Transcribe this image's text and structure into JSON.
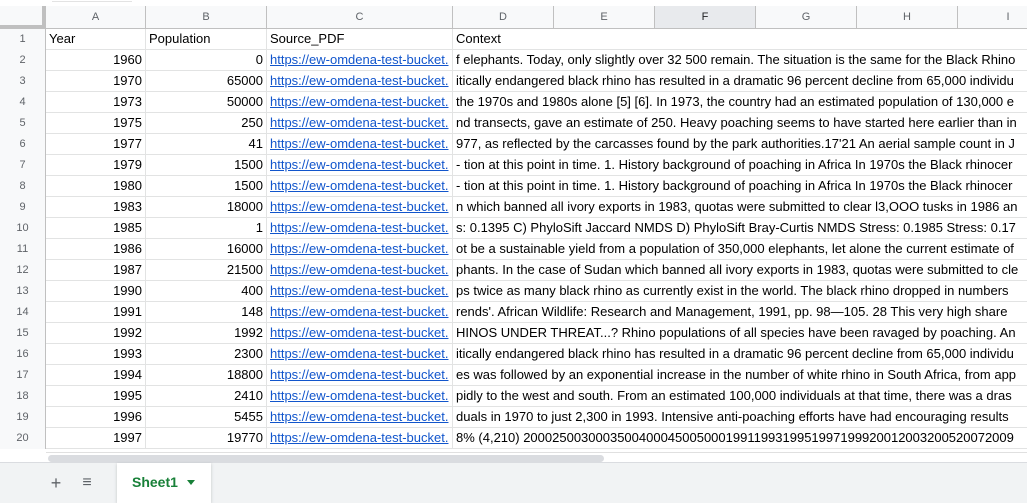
{
  "sheet": {
    "columns": [
      "A",
      "B",
      "C",
      "D",
      "E",
      "F",
      "G",
      "H",
      "I"
    ],
    "selected_column": "F",
    "headers": {
      "year": "Year",
      "population": "Population",
      "source": "Source_PDF",
      "context": "Context"
    },
    "rows": [
      {
        "n": "1",
        "year": "Year",
        "pop": "Population",
        "src": "Source_PDF",
        "ctx": "Context",
        "header": true
      },
      {
        "n": "2",
        "year": "1960",
        "pop": "0",
        "src": "https://ew-omdena-test-bucket.",
        "ctx": "f elephants. Today, only slightly over 32 500 remain. The situation is the same for the Black Rhino"
      },
      {
        "n": "3",
        "year": "1970",
        "pop": "65000",
        "src": "https://ew-omdena-test-bucket.",
        "ctx": "itically endangered black rhino has resulted in a dramatic 96 percent decline from 65,000 individu"
      },
      {
        "n": "4",
        "year": "1973",
        "pop": "50000",
        "src": "https://ew-omdena-test-bucket.",
        "ctx": "the 1970s and 1980s alone [5] [6]. In 1973, the country had an estimated population of 130,000 e"
      },
      {
        "n": "5",
        "year": "1975",
        "pop": "250",
        "src": "https://ew-omdena-test-bucket.",
        "ctx": "nd transects, gave an estimate of 250. Heavy poaching seems to have started here earlier than in"
      },
      {
        "n": "6",
        "year": "1977",
        "pop": "41",
        "src": "https://ew-omdena-test-bucket.",
        "ctx": "977, as reflected by the carcasses found by the park authorities.17'21 An aerial sample count in J"
      },
      {
        "n": "7",
        "year": "1979",
        "pop": "1500",
        "src": "https://ew-omdena-test-bucket.",
        "ctx": "- tion at this point in time. 1. History background of poaching in Africa In 1970s the Black rhinocer"
      },
      {
        "n": "8",
        "year": "1980",
        "pop": "1500",
        "src": "https://ew-omdena-test-bucket.",
        "ctx": "- tion at this point in time. 1. History background of poaching in Africa In 1970s the Black rhinocer"
      },
      {
        "n": "9",
        "year": "1983",
        "pop": "18000",
        "src": "https://ew-omdena-test-bucket.",
        "ctx": "n which banned all ivory exports in 1983, quotas were submitted to clear l3,OOO tusks in 1986 an"
      },
      {
        "n": "10",
        "year": "1985",
        "pop": "1",
        "src": "https://ew-omdena-test-bucket.",
        "ctx": "s: 0.1395 C) PhyloSift Jaccard NMDS D) PhyloSift Bray-Curtis NMDS Stress: 0.1985 Stress: 0.17"
      },
      {
        "n": "11",
        "year": "1986",
        "pop": "16000",
        "src": "https://ew-omdena-test-bucket.",
        "ctx": "ot be a sustainable yield from a population of 350,000 elephants, let alone the current estimate of"
      },
      {
        "n": "12",
        "year": "1987",
        "pop": "21500",
        "src": "https://ew-omdena-test-bucket.",
        "ctx": "phants. In the case of Sudan which banned all ivory exports in 1983, quotas were submitted to cle"
      },
      {
        "n": "13",
        "year": "1990",
        "pop": "400",
        "src": "https://ew-omdena-test-bucket.",
        "ctx": "ps twice as many black rhino as currently exist in the world. The black rhino dropped in numbers"
      },
      {
        "n": "14",
        "year": "1991",
        "pop": "148",
        "src": "https://ew-omdena-test-bucket.",
        "ctx": "rends'. African Wildlife: Research and Management, 1991, pp. 98—105. 28 This very high share"
      },
      {
        "n": "15",
        "year": "1992",
        "pop": "1992",
        "src": "https://ew-omdena-test-bucket.",
        "ctx": "HINOS UNDER THREAT...? Rhino populations of all species have been ravaged by poaching. An"
      },
      {
        "n": "16",
        "year": "1993",
        "pop": "2300",
        "src": "https://ew-omdena-test-bucket.",
        "ctx": "itically endangered black rhino has resulted in a dramatic 96 percent decline from 65,000 individu"
      },
      {
        "n": "17",
        "year": "1994",
        "pop": "18800",
        "src": "https://ew-omdena-test-bucket.",
        "ctx": "es was followed by an exponential increase in the number of white rhino in South Africa, from app"
      },
      {
        "n": "18",
        "year": "1995",
        "pop": "2410",
        "src": "https://ew-omdena-test-bucket.",
        "ctx": "pidly to the west and south. From an estimated 100,000 individuals at that time, there was a dras"
      },
      {
        "n": "19",
        "year": "1996",
        "pop": "5455",
        "src": "https://ew-omdena-test-bucket.",
        "ctx": "duals in 1970 to just 2,300 in 1993. Intensive anti-poaching efforts have had encouraging results"
      },
      {
        "n": "20",
        "year": "1997",
        "pop": "19770",
        "src": "https://ew-omdena-test-bucket.",
        "ctx": "8% (4,210) 20002500300035004000450050001991199319951997199920012003200520072009"
      }
    ]
  },
  "sheet_bar": {
    "add_icon": "plus-icon",
    "list_icon": "all-sheets-icon",
    "tab_label": "Sheet1",
    "tab_color": "#188038"
  },
  "colors": {
    "link": "#1155cc",
    "header_bg": "#f8f9fa",
    "grid": "#e2e3e3"
  }
}
